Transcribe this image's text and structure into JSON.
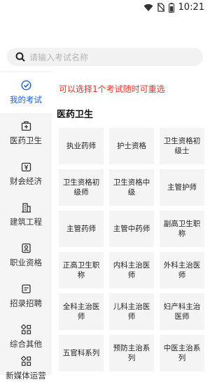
{
  "status": {
    "time": "10:21",
    "icons": [
      "wifi-icon",
      "no-sim-icon",
      "battery-icon"
    ]
  },
  "search": {
    "placeholder": "请输入考试名称",
    "icon": "search-icon"
  },
  "sidebar": {
    "active_color": "#1a5fd9",
    "items": [
      {
        "label": "我的考试",
        "icon": "check-circle-icon",
        "active": true
      },
      {
        "label": "医药卫生",
        "icon": "medical-kit-icon",
        "active": false
      },
      {
        "label": "财会经济",
        "icon": "yen-icon",
        "active": false
      },
      {
        "label": "建筑工程",
        "icon": "building-icon",
        "active": false
      },
      {
        "label": "职业资格",
        "icon": "person-badge-icon",
        "active": false
      },
      {
        "label": "招录招聘",
        "icon": "tag-icon",
        "active": false
      },
      {
        "label": "综合其他",
        "icon": "grid-plus-icon",
        "active": false
      },
      {
        "label": "新媒体运营",
        "icon": "grid-plus-icon",
        "active": false
      }
    ]
  },
  "main": {
    "notice": "可以选择1个考试随时可重选",
    "notice_color": "#e0362c",
    "section_title": "医药卫生",
    "exams": [
      "执业药师",
      "护士资格",
      "卫生资格初级士",
      "卫生资格初级师",
      "卫生资格中级",
      "主管护师",
      "主管药师",
      "主管中药师",
      "副高卫生职称",
      "正高卫生职称",
      "内科主治医师",
      "外科主治医师",
      "全科主治医师",
      "儿科主治医师",
      "妇产科主治医师",
      "五官科系列",
      "预防主治系列",
      "中医主治系列"
    ]
  }
}
